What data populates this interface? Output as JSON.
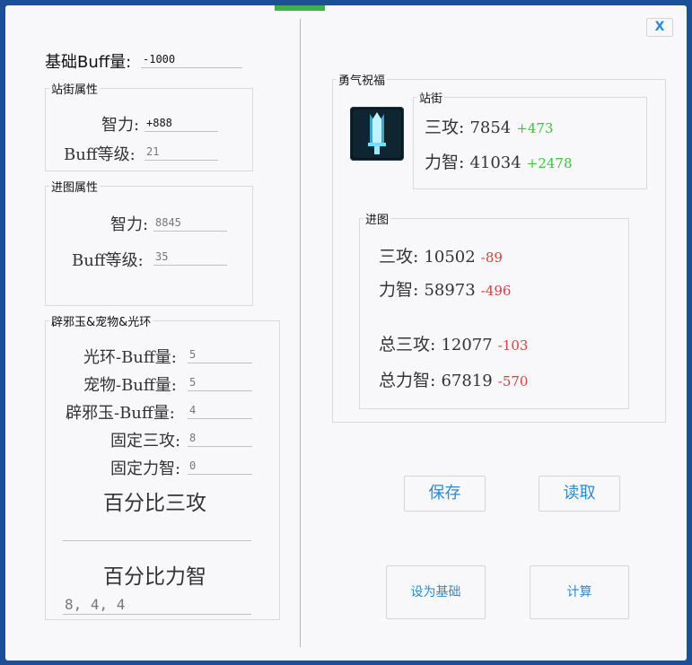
{
  "close_label": "X",
  "base_buff": {
    "label": "基础Buff量:",
    "value": "-1000"
  },
  "station": {
    "title": "站街属性",
    "int_label": "智力:",
    "int_value": "+888",
    "level_label": "Buff等级:",
    "level_value": "21"
  },
  "dungeon": {
    "title": "进图属性",
    "int_label": "智力:",
    "int_value": "8845",
    "level_label": "Buff等级:",
    "level_value": "35"
  },
  "extras": {
    "title": "辟邪玉&宠物&光环",
    "aura_label": "光环-Buff量:",
    "aura_value": "5",
    "pet_label": "宠物-Buff量:",
    "pet_value": "5",
    "jade_label": "辟邪玉-Buff量:",
    "jade_value": "4",
    "fixed_atk_label": "固定三攻:",
    "fixed_atk_value": "8",
    "fixed_int_label": "固定力智:",
    "fixed_int_value": "0",
    "pct_atk_label": "百分比三攻",
    "pct_int_label": "百分比力智",
    "pct_int_value": "8, 4, 4"
  },
  "blessing": {
    "title": "勇气祝福",
    "icon": "sword-skill-icon",
    "station": {
      "title": "站街",
      "atk_label": "三攻:",
      "atk_value": "7854",
      "atk_delta": "+473",
      "int_label": "力智:",
      "int_value": "41034",
      "int_delta": "+2478"
    },
    "dungeon": {
      "title": "进图",
      "atk_label": "三攻:",
      "atk_value": "10502",
      "atk_delta": "-89",
      "int_label": "力智:",
      "int_value": "58973",
      "int_delta": "-496",
      "total_atk_label": "总三攻:",
      "total_atk_value": "12077",
      "total_atk_delta": "-103",
      "total_int_label": "总力智:",
      "total_int_value": "67819",
      "total_int_delta": "-570"
    }
  },
  "buttons": {
    "save": "保存",
    "load": "读取",
    "set_base": "设为基础",
    "calc": "计算"
  },
  "colors": {
    "accent": "#2d8ad3",
    "positive": "#3ec43e",
    "negative": "#e03c3c"
  }
}
